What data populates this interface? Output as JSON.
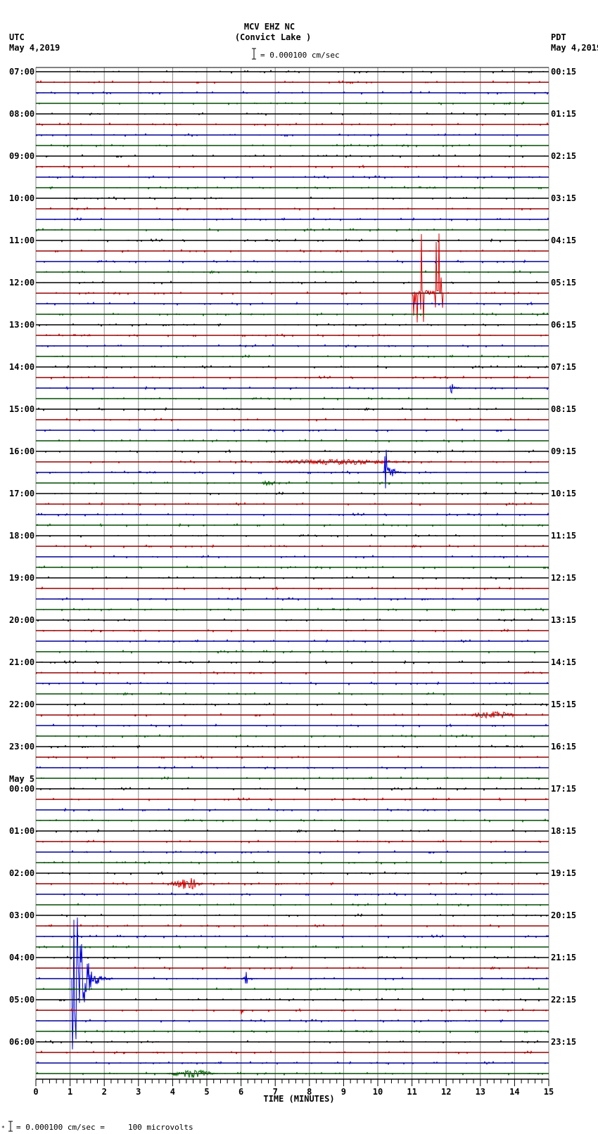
{
  "header": {
    "station": "MCV EHZ NC",
    "location": "(Convict Lake )",
    "left_zone": "UTC",
    "left_date": "May 4,2019",
    "right_zone": "PDT",
    "right_date": "May 4,2019",
    "scale": "= 0.000100 cm/sec"
  },
  "footer": {
    "scale_note": "= 0.000100 cm/sec =     100 microvolts"
  },
  "colors": {
    "trace_cycle": [
      "#000000",
      "#e00000",
      "#0000e0",
      "#007000"
    ],
    "grid": "#888888"
  },
  "chart_data": {
    "type": "line",
    "title": "MCV EHZ NC (Convict Lake )",
    "xlabel": "TIME (MINUTES)",
    "xlim": [
      0,
      15
    ],
    "x_ticks": [
      "0",
      "1",
      "2",
      "3",
      "4",
      "5",
      "6",
      "7",
      "8",
      "9",
      "10",
      "11",
      "12",
      "13",
      "14",
      "15"
    ],
    "traces_per_hour": 4,
    "trace_count": 96,
    "left_labels": [
      "07:00",
      "08:00",
      "09:00",
      "10:00",
      "11:00",
      "12:00",
      "13:00",
      "14:00",
      "15:00",
      "16:00",
      "17:00",
      "18:00",
      "19:00",
      "20:00",
      "21:00",
      "22:00",
      "23:00",
      "00:00",
      "01:00",
      "02:00",
      "03:00",
      "04:00",
      "05:00",
      "06:00"
    ],
    "day_change_label": "May 5",
    "right_labels": [
      "00:15",
      "01:15",
      "02:15",
      "03:15",
      "04:15",
      "05:15",
      "06:15",
      "07:15",
      "08:15",
      "09:15",
      "10:15",
      "11:15",
      "12:15",
      "13:15",
      "14:15",
      "15:15",
      "16:15",
      "17:15",
      "18:15",
      "19:15",
      "20:15",
      "21:15",
      "22:15",
      "23:15"
    ],
    "events": [
      {
        "trace": 21,
        "minute": 11.0,
        "duration": 0.9,
        "amplitude": 6,
        "kind": "spikes"
      },
      {
        "trace": 30,
        "minute": 12.1,
        "duration": 0.5,
        "amplitude": 0.9,
        "kind": "quake"
      },
      {
        "trace": 37,
        "minute": 6.5,
        "duration": 4.7,
        "amplitude": 0.25,
        "kind": "noise"
      },
      {
        "trace": 38,
        "minute": 10.2,
        "duration": 0.6,
        "amplitude": 3.5,
        "kind": "quake"
      },
      {
        "trace": 39,
        "minute": 6.6,
        "duration": 0.4,
        "amplitude": 0.3,
        "kind": "noise"
      },
      {
        "trace": 61,
        "minute": 12.6,
        "duration": 1.6,
        "amplitude": 0.35,
        "kind": "noise"
      },
      {
        "trace": 77,
        "minute": 3.9,
        "duration": 1.0,
        "amplitude": 0.6,
        "kind": "noise"
      },
      {
        "trace": 86,
        "minute": 1.05,
        "duration": 1.2,
        "amplitude": 12,
        "kind": "quake"
      },
      {
        "trace": 86,
        "minute": 6.1,
        "duration": 0.3,
        "amplitude": 1.6,
        "kind": "quake"
      },
      {
        "trace": 89,
        "minute": 6.0,
        "duration": 0.2,
        "amplitude": 1.0,
        "kind": "quake"
      },
      {
        "trace": 95,
        "minute": 3.8,
        "duration": 1.5,
        "amplitude": 0.4,
        "kind": "noise"
      }
    ]
  }
}
